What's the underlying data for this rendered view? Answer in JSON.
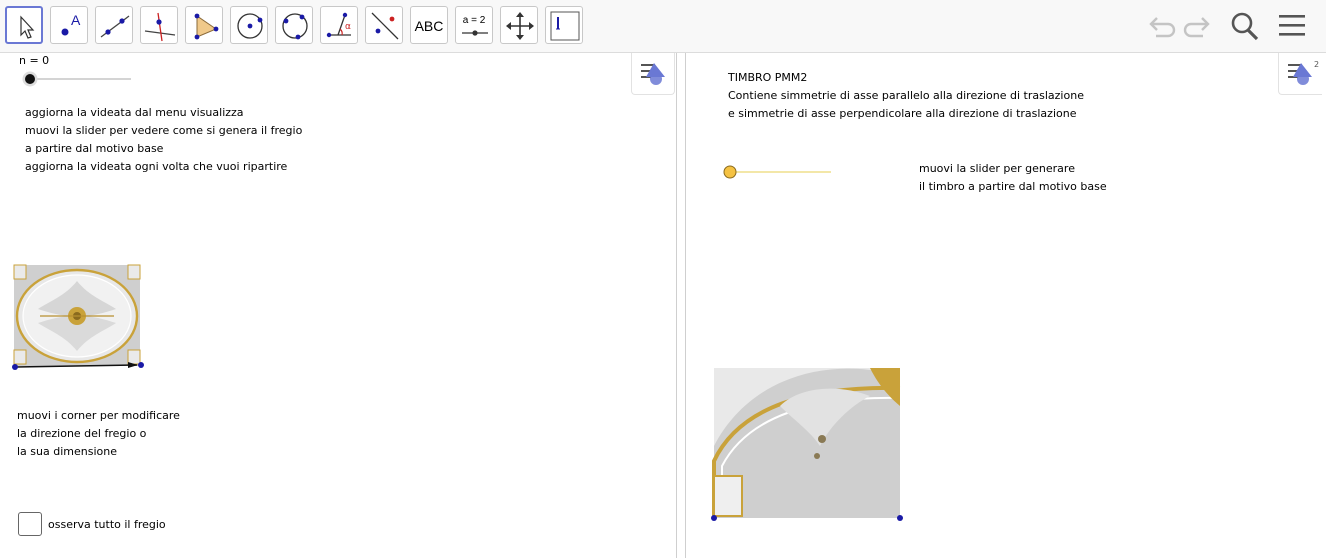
{
  "toolbar": {
    "tools": [
      {
        "name": "move-tool",
        "label": ""
      },
      {
        "name": "point-tool",
        "label": "A"
      },
      {
        "name": "line-tool",
        "label": ""
      },
      {
        "name": "perpendicular-tool",
        "label": ""
      },
      {
        "name": "polygon-tool",
        "label": ""
      },
      {
        "name": "circle-tool",
        "label": ""
      },
      {
        "name": "circle-three-points-tool",
        "label": ""
      },
      {
        "name": "angle-tool",
        "label": "α"
      },
      {
        "name": "reflect-tool",
        "label": ""
      },
      {
        "name": "text-tool",
        "label": "ABC"
      },
      {
        "name": "slider-tool",
        "label": "a = 2"
      },
      {
        "name": "move-graphics-tool",
        "label": ""
      },
      {
        "name": "image-tool",
        "label": ""
      }
    ]
  },
  "left": {
    "slider_label": "n = 0",
    "slider_value": 0,
    "instructions": [
      "aggiorna la videata dal menu visualizza",
      "muovi la slider per vedere come si genera il fregio",
      "a partire dal motivo base",
      "aggiorna la videata ogni volta che vuoi ripartire"
    ],
    "corner_instructions": [
      "muovi i corner per modificare",
      "la direzione del fregio o",
      "la sua dimensione"
    ],
    "checkbox_label": "osserva tutto il fregio",
    "checkbox_checked": false
  },
  "right": {
    "title_lines": [
      "TIMBRO PMM2",
      "Contiene simmetrie di asse parallelo alla direzione di traslazione",
      "e simmetrie di asse perpendicolare alla direzione di traslazione"
    ],
    "slider_text": [
      "muovi la slider per generare",
      "il timbro a partire dal motivo base"
    ],
    "style_bar_index": "2"
  },
  "colors": {
    "accent": "#6a78d4",
    "point": "#1a1aa6",
    "slider_yellow": "#f5c242",
    "gold": "#c9a23a"
  }
}
